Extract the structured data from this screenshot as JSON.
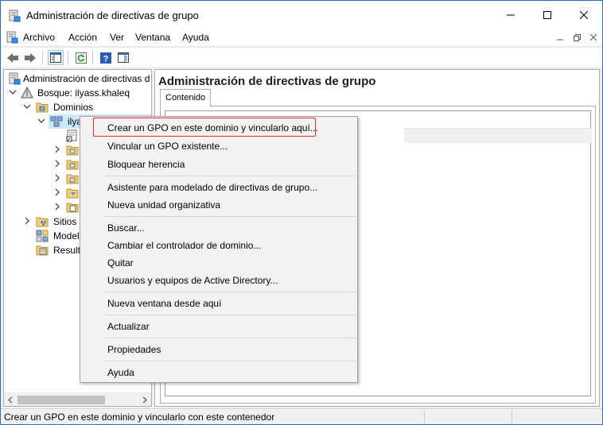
{
  "window": {
    "title": "Administración de directivas de grupo"
  },
  "menubar": {
    "items": [
      "Archivo",
      "Acción",
      "Ver",
      "Ventana",
      "Ayuda"
    ]
  },
  "tree": {
    "root": "Administración de directivas d",
    "forest": "Bosque: ilyass.khaleq",
    "domains": "Dominios",
    "domain": "ilya",
    "sites": "Sitios",
    "modeling": "Model",
    "results": "Result"
  },
  "right_pane": {
    "title": "Administración de directivas de grupo",
    "tab": "Contenido"
  },
  "context_menu": {
    "items": [
      "Crear un GPO en este dominio y vincularlo aquí...",
      "Vincular un GPO existente...",
      "Bloquear herencia",
      "Asistente para modelado de directivas de grupo...",
      "Nueva unidad organizativa",
      "Buscar...",
      "Cambiar el controlador de dominio...",
      "Quitar",
      "Usuarios y equipos de Active Directory...",
      "Nueva ventana desde aquí",
      "Actualizar",
      "Propiedades",
      "Ayuda"
    ],
    "highlight_color": "#e8283a"
  },
  "statusbar": {
    "text": "Crear un GPO en este dominio y vincularlo con este contenedor"
  },
  "icons": {
    "app": "gpmc-icon",
    "back": "back-arrow-icon",
    "forward": "forward-arrow-icon",
    "console_tree": "show-hide-tree-icon",
    "refresh": "refresh-icon",
    "help": "help-icon",
    "action_pane": "action-pane-icon"
  }
}
